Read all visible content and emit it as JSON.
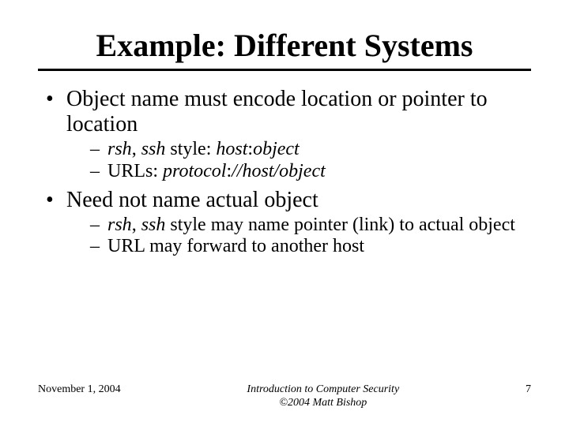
{
  "title": "Example: Different Systems",
  "bullets": {
    "b1": {
      "text": "Object name must encode location or pointer to location",
      "sub": {
        "s1a": "rsh",
        "s1b": ", ",
        "s1c": "ssh",
        "s1d": " style: ",
        "s1e": "host",
        "s1f": ":",
        "s1g": "object",
        "s2a": "URLs: ",
        "s2b": "protocol",
        "s2c": ":",
        "s2d": "//host/object"
      }
    },
    "b2": {
      "text": "Need not name actual object",
      "sub": {
        "s1a": "rsh",
        "s1b": ", ",
        "s1c": "ssh",
        "s1d": " style may name pointer (link) to actual object",
        "s2": "URL may forward to another host"
      }
    }
  },
  "footer": {
    "date": "November 1, 2004",
    "mid1": "Introduction to Computer Security",
    "mid2": "©2004 Matt Bishop",
    "page": "7"
  }
}
